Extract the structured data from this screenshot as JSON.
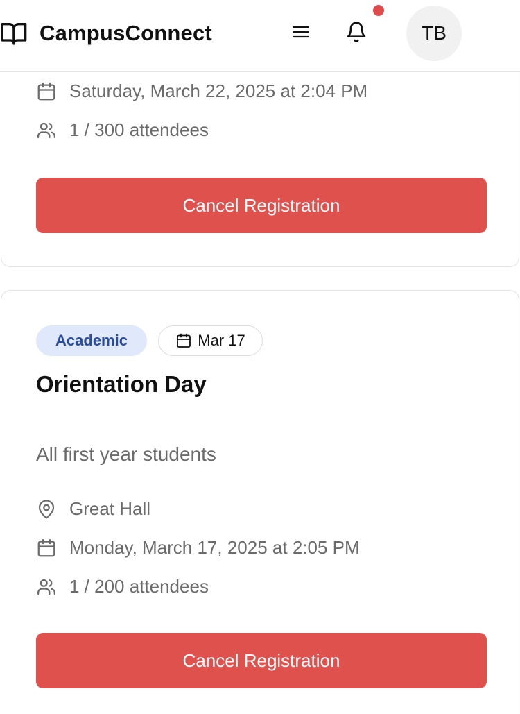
{
  "header": {
    "app_name": "CampusConnect",
    "avatar_initials": "TB",
    "notification_dot_color": "#dd4b4b",
    "icons": [
      "book-open-icon",
      "menu-icon",
      "bell-icon"
    ]
  },
  "events": [
    {
      "datetime": "Saturday, March 22, 2025 at 2:04 PM",
      "attendees": "1 / 300 attendees",
      "action_label": "Cancel Registration"
    },
    {
      "category": "Academic",
      "date_badge": "Mar 17",
      "title": "Orientation Day",
      "description": "All first year students",
      "location": "Great Hall",
      "datetime": "Monday, March 17, 2025 at 2:05 PM",
      "attendees": "1 / 200 attendees",
      "action_label": "Cancel Registration"
    }
  ],
  "colors": {
    "danger": "#de514d",
    "badge_bg": "#dfe9fb",
    "badge_text": "#2b4c9b",
    "muted_text": "#6b6b6b"
  }
}
